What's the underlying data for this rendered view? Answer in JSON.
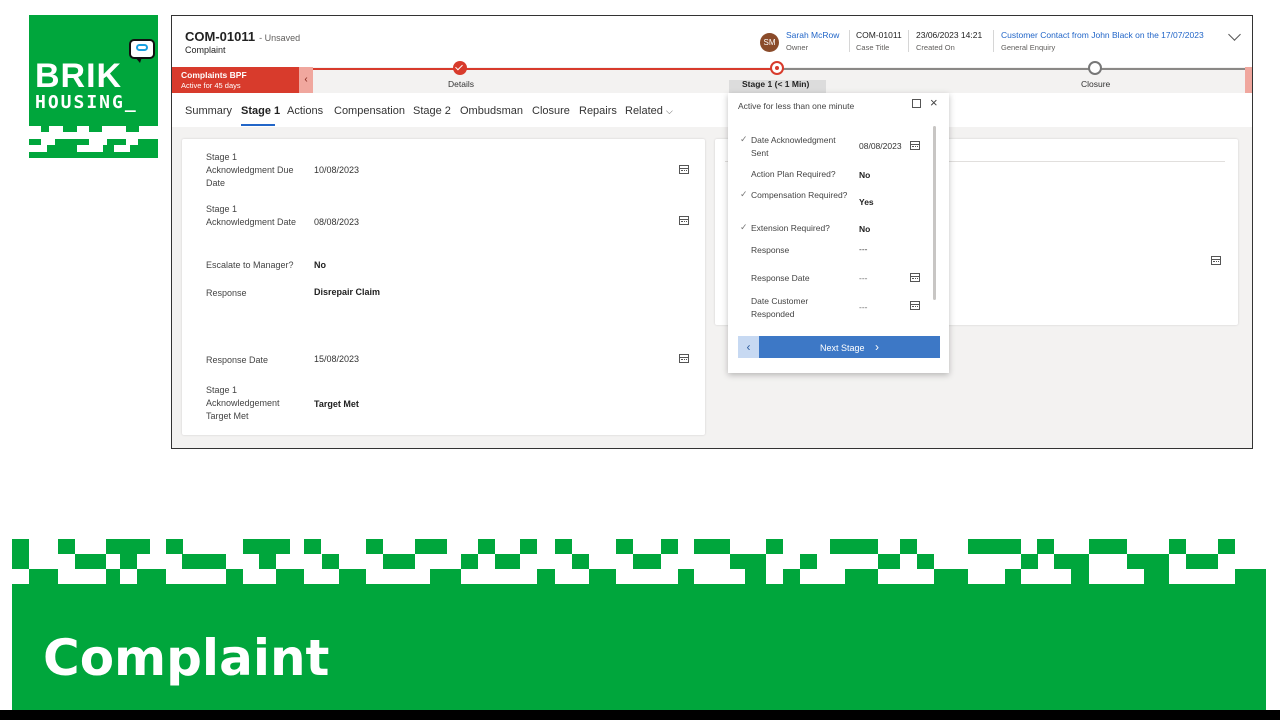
{
  "slide": {
    "title": "Complaint",
    "brand_green": "#00a63c"
  },
  "logo": {
    "line1": "BRIK",
    "line2": "HOUSING_",
    "icon": "chat-bubble-icon"
  },
  "record": {
    "id": "COM-01011",
    "unsaved": "- Unsaved",
    "entity": "Complaint",
    "owner_initials": "SM",
    "owner_name": "Sarah McRow",
    "owner_label": "Owner",
    "case_title_value": "COM-01011",
    "case_title_label": "Case Title",
    "created_on_value": "23/06/2023 14:21",
    "created_on_label": "Created On",
    "enquiry_value": "Customer Contact from John Black on the 17/07/2023",
    "enquiry_label": "General Enquiry"
  },
  "bpf": {
    "name": "Complaints BPF",
    "active_for": "Active for 45 days",
    "accent": "#d83b2c",
    "stages": [
      {
        "label": "Details",
        "state": "done"
      },
      {
        "label": "Stage 1",
        "suffix": "(< 1 Min)",
        "state": "active"
      },
      {
        "label": "Closure",
        "state": "todo"
      }
    ]
  },
  "tabs": [
    "Summary",
    "Stage 1",
    "Actions",
    "Compensation",
    "Stage 2",
    "Ombudsman",
    "Closure",
    "Repairs",
    "Related"
  ],
  "active_tab": "Stage 1",
  "form": {
    "fields": [
      {
        "label": "Stage 1 Acknowledgment Due Date",
        "value": "10/08/2023"
      },
      {
        "label": "Stage 1 Acknowledgment Date",
        "value": "08/08/2023"
      },
      {
        "label": "Escalate to Manager?",
        "value": "No"
      },
      {
        "label": "Response",
        "value": "Disrepair Claim"
      },
      {
        "label": "Response Date",
        "value": "15/08/2023"
      },
      {
        "label": "Stage 1 Acknowledgement Target Met",
        "value": "Target Met"
      }
    ]
  },
  "flyout": {
    "title": "Active for less than one minute",
    "fields": [
      {
        "label": "Date Acknowledgment Sent",
        "value": "08/08/2023",
        "checked": true
      },
      {
        "label": "Action Plan Required?",
        "value": "No",
        "checked": false
      },
      {
        "label": "Compensation Required?",
        "value": "Yes",
        "checked": true
      },
      {
        "label": "Extension Required?",
        "value": "No",
        "checked": true
      },
      {
        "label": "Response",
        "value": "---",
        "checked": false
      },
      {
        "label": "Response Date",
        "value": "---",
        "checked": false
      },
      {
        "label": "Date Customer Responded",
        "value": "---",
        "checked": false
      }
    ],
    "next_label": "Next Stage"
  }
}
